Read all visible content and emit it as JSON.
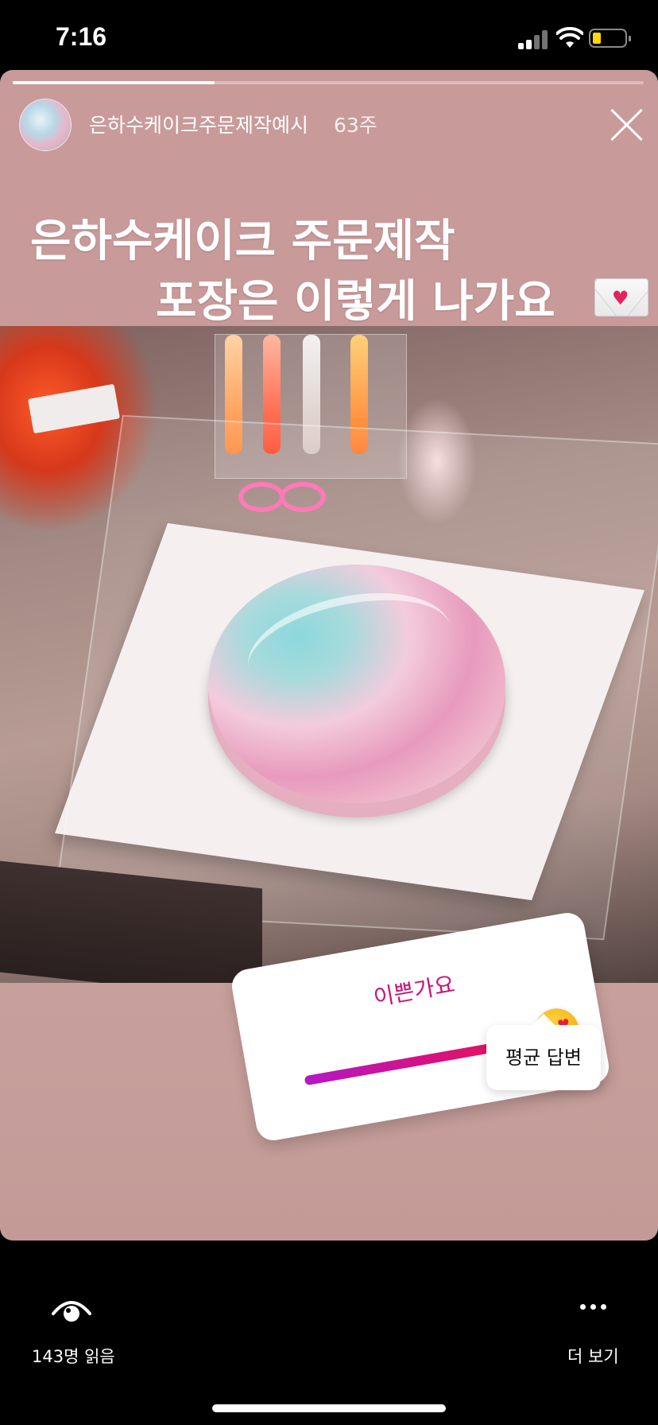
{
  "status_bar": {
    "time": "7:16",
    "battery_level": 0.25,
    "battery_color": "#ffd60a"
  },
  "story": {
    "progress": 0.32,
    "username": "은하수케이크주문제작예시",
    "timestamp": "63주",
    "caption_line1": "은하수케이크 주문제작",
    "caption_line2": "포장은 이렇게 나가요",
    "caption_emoji": "envelope-heart-icon",
    "background_color": "#c99a9a"
  },
  "poll": {
    "question": "이쁜가요",
    "average_label": "평균 답변",
    "average_value": 0.95,
    "emoji": "heart-eyes-emoji",
    "track_colors": [
      "#b318c4",
      "#e91c3a"
    ]
  },
  "bottom_bar": {
    "viewers_label": "143명 읽음",
    "more_label": "더 보기"
  }
}
